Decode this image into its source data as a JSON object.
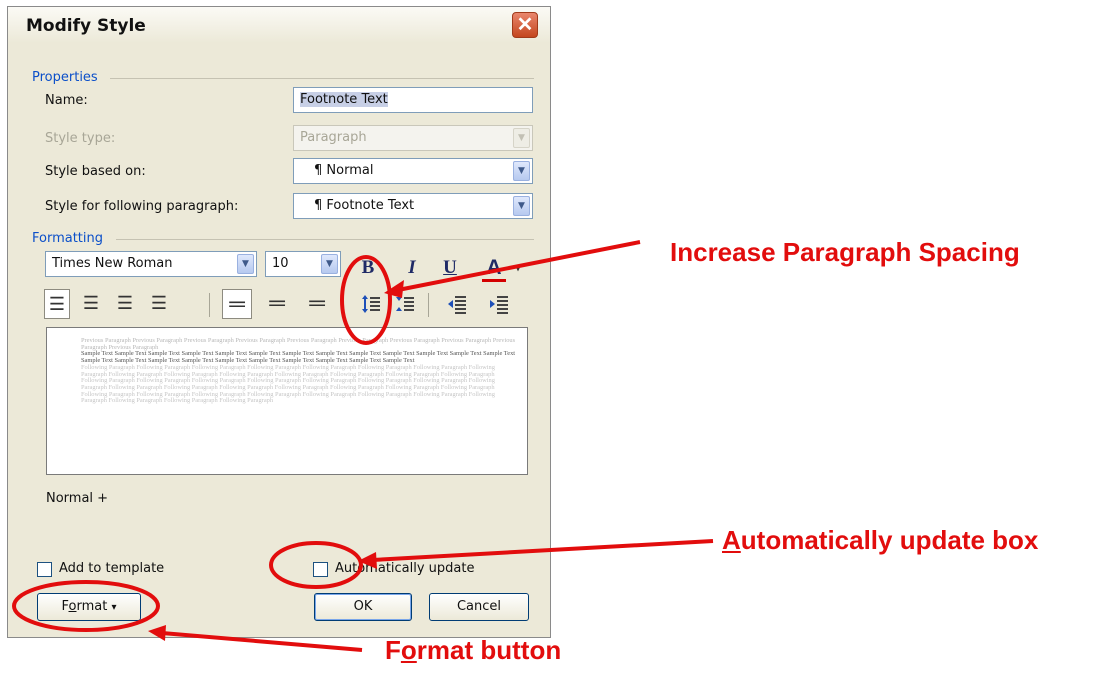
{
  "dialog": {
    "title": "Modify Style",
    "close_glyph": "✕",
    "properties": {
      "group_label": "Properties",
      "name_label": "Name:",
      "name_value": "Footnote Text",
      "style_type_label": "Style type:",
      "style_type_value": "Paragraph",
      "based_on_label": "Style based on:",
      "based_on_value": "¶ Normal",
      "following_label": "Style for following paragraph:",
      "following_value": "¶ Footnote Text"
    },
    "formatting": {
      "group_label": "Formatting",
      "font_name": "Times New Roman",
      "font_size": "10",
      "bold": "B",
      "italic": "I",
      "underline": "U",
      "font_color": "A"
    },
    "preview": {
      "previous_paragraph": "Previous Paragraph Previous Paragraph Previous Paragraph Previous Paragraph Previous Paragraph Previous Paragraph Previous Paragraph Previous Paragraph Previous Paragraph Previous Paragraph",
      "sample_text": "Sample Text Sample Text Sample Text Sample Text Sample Text Sample Text Sample Text Sample Text Sample Text Sample Text Sample Text Sample Text Sample Text Sample Text Sample Text Sample Text Sample Text Sample Text Sample Text Sample Text Sample Text Sample Text Sample Text",
      "following_paragraph": "Following Paragraph Following Paragraph Following Paragraph Following Paragraph Following Paragraph Following Paragraph Following Paragraph Following Paragraph Following Paragraph Following Paragraph Following Paragraph Following Paragraph Following Paragraph Following Paragraph Following Paragraph Following Paragraph Following Paragraph Following Paragraph Following Paragraph Following Paragraph Following Paragraph Following Paragraph Following Paragraph Following Paragraph Following Paragraph Following Paragraph Following Paragraph Following Paragraph Following Paragraph Following Paragraph Following Paragraph Following Paragraph Following Paragraph Following Paragraph Following Paragraph Following Paragraph Following Paragraph Following Paragraph Following Paragraph Following Paragraph Following Paragraph"
    },
    "description": "Normal +",
    "add_to_template_label": "Add to template",
    "auto_update_label": "Automatically update",
    "format_button": {
      "pre": "F",
      "underline_char": "o",
      "post": "rmat",
      "arrow": "▾"
    },
    "ok_label": "OK",
    "cancel_label": "Cancel"
  },
  "annotations": {
    "increase_spacing": "Increase Paragraph Spacing",
    "auto_update": {
      "first_char": "A",
      "rest": "utomatically update box"
    },
    "format_button": {
      "pre": "F",
      "underline_char": "o",
      "post": "rmat button"
    }
  },
  "icons": [
    "close-icon",
    "dropdown-arrow-icon",
    "bold-icon",
    "italic-icon",
    "underline-icon",
    "font-color-icon",
    "align-left-icon",
    "align-center-icon",
    "align-right-icon",
    "justify-icon",
    "single-spacing-icon",
    "one-half-spacing-icon",
    "double-spacing-icon",
    "increase-paragraph-spacing-icon",
    "decrease-paragraph-spacing-icon",
    "decrease-indent-icon",
    "increase-indent-icon"
  ],
  "colors": {
    "accent": "#0b4fc9",
    "annotation_red": "#e20d0d",
    "dialog_bg": "#ece9d8"
  }
}
